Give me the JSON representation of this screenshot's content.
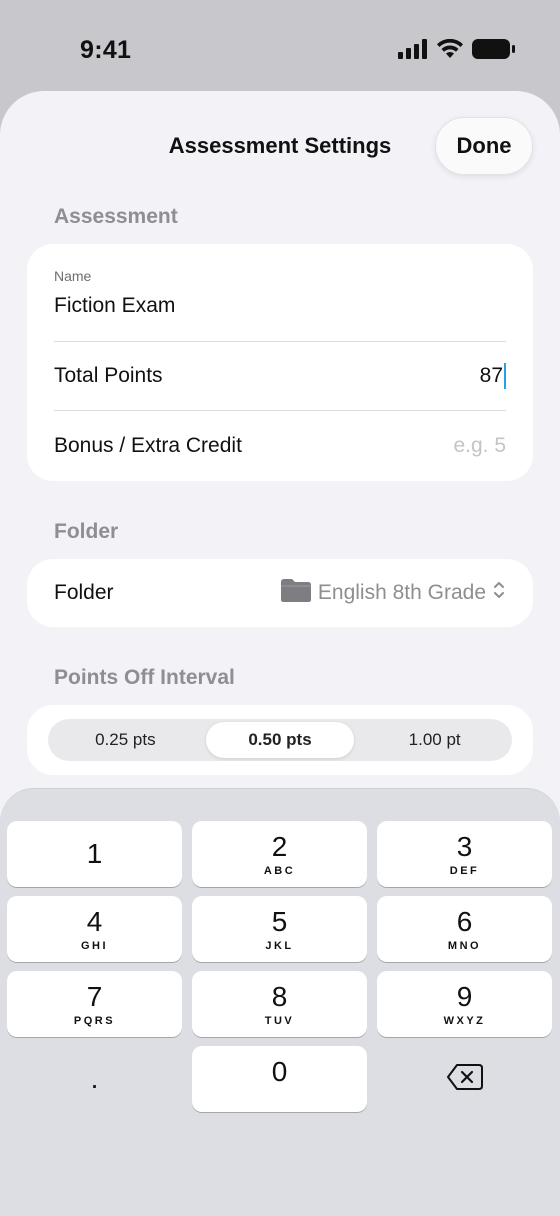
{
  "status": {
    "time": "9:41",
    "icons": [
      "cellular-signal-icon",
      "wifi-icon",
      "battery-icon"
    ]
  },
  "sheet": {
    "title": "Assessment Settings",
    "done_label": "Done"
  },
  "assessment": {
    "header": "Assessment",
    "name_caption": "Name",
    "name_value": "Fiction Exam",
    "total_points_label": "Total Points",
    "total_points_value": "87",
    "bonus_label": "Bonus / Extra Credit",
    "bonus_placeholder": "e.g. 5"
  },
  "folder": {
    "header": "Folder",
    "label": "Folder",
    "value": "English 8th Grade",
    "icon": "folder-icon"
  },
  "points_off": {
    "header": "Points Off Interval",
    "options": [
      "0.25 pts",
      "0.50 pts",
      "1.00 pt"
    ],
    "selected_index": 1
  },
  "keypad": {
    "keys": [
      {
        "num": "1",
        "letters": ""
      },
      {
        "num": "2",
        "letters": "ABC"
      },
      {
        "num": "3",
        "letters": "DEF"
      },
      {
        "num": "4",
        "letters": "GHI"
      },
      {
        "num": "5",
        "letters": "JKL"
      },
      {
        "num": "6",
        "letters": "MNO"
      },
      {
        "num": "7",
        "letters": "PQRS"
      },
      {
        "num": "8",
        "letters": "TUV"
      },
      {
        "num": "9",
        "letters": "WXYZ"
      },
      {
        "num": ".",
        "letters": ""
      },
      {
        "num": "0",
        "letters": ""
      }
    ],
    "delete_icon": "delete-backward-icon"
  },
  "colors": {
    "sheet_bg": "#f2f2f7",
    "caret": "#2aa0e4",
    "secondary_text": "#8e8e93"
  }
}
